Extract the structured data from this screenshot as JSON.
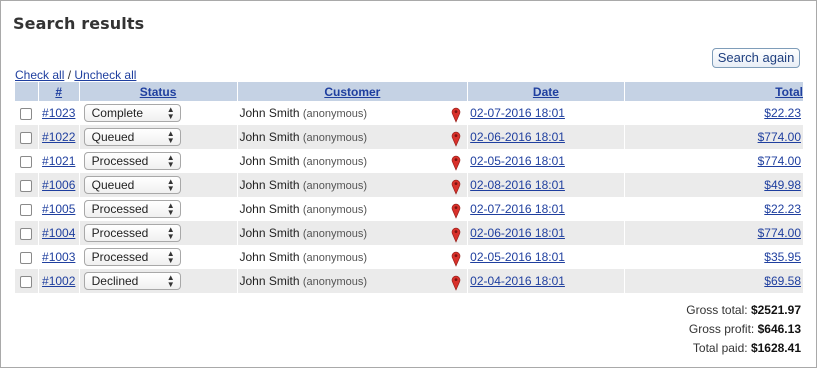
{
  "page": {
    "title": "Search results",
    "search_again": "Search again"
  },
  "selection": {
    "check_all": "Check all",
    "separator": "/",
    "uncheck_all": "Uncheck all"
  },
  "columns": {
    "num": "#",
    "status": "Status",
    "customer": "Customer",
    "date": "Date",
    "total": "Total"
  },
  "orders": [
    {
      "num": "#1023",
      "status": "Complete",
      "customer": "John Smith",
      "customer_note": "(anonymous)",
      "date": "02-07-2016 18:01",
      "total": "$22.23"
    },
    {
      "num": "#1022",
      "status": "Queued",
      "customer": "John Smith",
      "customer_note": "(anonymous)",
      "date": "02-06-2016 18:01",
      "total": "$774.00"
    },
    {
      "num": "#1021",
      "status": "Processed",
      "customer": "John Smith",
      "customer_note": "(anonymous)",
      "date": "02-05-2016 18:01",
      "total": "$774.00"
    },
    {
      "num": "#1006",
      "status": "Queued",
      "customer": "John Smith",
      "customer_note": "(anonymous)",
      "date": "02-08-2016 18:01",
      "total": "$49.98"
    },
    {
      "num": "#1005",
      "status": "Processed",
      "customer": "John Smith",
      "customer_note": "(anonymous)",
      "date": "02-07-2016 18:01",
      "total": "$22.23"
    },
    {
      "num": "#1004",
      "status": "Processed",
      "customer": "John Smith",
      "customer_note": "(anonymous)",
      "date": "02-06-2016 18:01",
      "total": "$774.00"
    },
    {
      "num": "#1003",
      "status": "Processed",
      "customer": "John Smith",
      "customer_note": "(anonymous)",
      "date": "02-05-2016 18:01",
      "total": "$35.95"
    },
    {
      "num": "#1002",
      "status": "Declined",
      "customer": "John Smith",
      "customer_note": "(anonymous)",
      "date": "02-04-2016 18:01",
      "total": "$69.58"
    }
  ],
  "icons": {
    "location": "map-pin-icon",
    "select_arrows": "up-down-arrows-icon"
  },
  "summary": {
    "gross_total_label": "Gross total:",
    "gross_total": "$2521.97",
    "gross_profit_label": "Gross profit:",
    "gross_profit": "$646.13",
    "total_paid_label": "Total paid:",
    "total_paid": "$1628.41"
  },
  "colors": {
    "header_bg": "#c5d2e4",
    "row_alt_bg": "#ebebeb",
    "link": "#1f3f9f",
    "pin": "#d9312b"
  }
}
